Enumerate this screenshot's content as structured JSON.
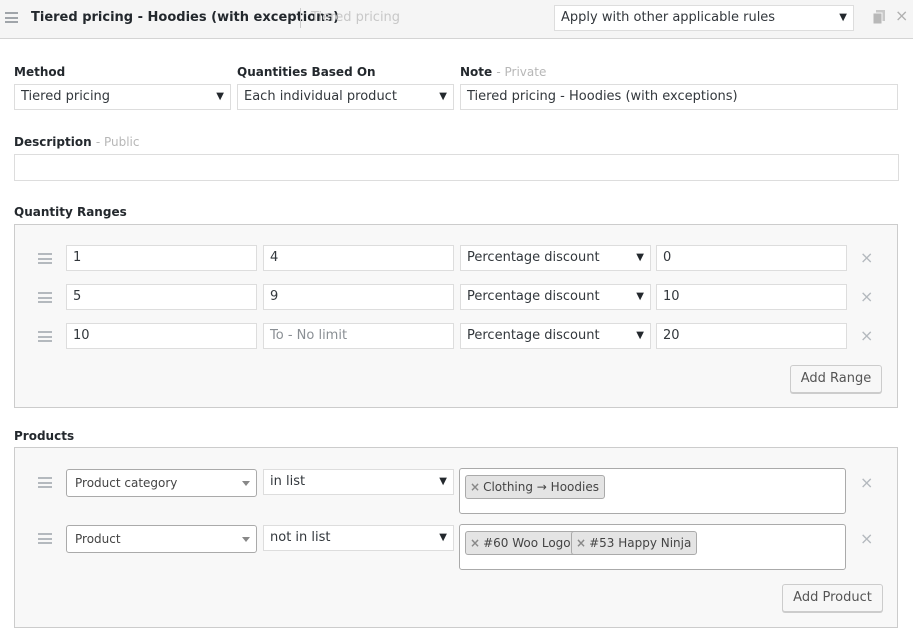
{
  "header": {
    "title": "Tiered pricing - Hoodies (with exceptions)",
    "subtitle": "Tiered pricing",
    "apply_select": "Apply with other applicable rules"
  },
  "fields": {
    "method_label": "Method",
    "method_value": "Tiered pricing",
    "quantities_label": "Quantities Based On",
    "quantities_value": "Each individual product",
    "note_label": "Note",
    "note_hint": "- Private",
    "note_value": "Tiered pricing - Hoodies (with exceptions)",
    "description_label": "Description",
    "description_hint": "- Public",
    "description_value": ""
  },
  "ranges": {
    "label": "Quantity Ranges",
    "to_placeholder": "To - No limit",
    "rows": [
      {
        "from": "1",
        "to": "4",
        "type": "Percentage discount",
        "value": "0"
      },
      {
        "from": "5",
        "to": "9",
        "type": "Percentage discount",
        "value": "10"
      },
      {
        "from": "10",
        "to": "",
        "type": "Percentage discount",
        "value": "20"
      }
    ],
    "add_label": "Add Range"
  },
  "products": {
    "label": "Products",
    "rows": [
      {
        "type": "Product category",
        "condition": "in list",
        "tags": [
          "Clothing → Hoodies"
        ]
      },
      {
        "type": "Product",
        "condition": "not in list",
        "tags": [
          "#60 Woo Logo",
          "#53 Happy Ninja"
        ]
      }
    ],
    "add_label": "Add Product"
  },
  "icons": {
    "arrow": "▼",
    "remove": "×",
    "tag_remove": "×"
  }
}
